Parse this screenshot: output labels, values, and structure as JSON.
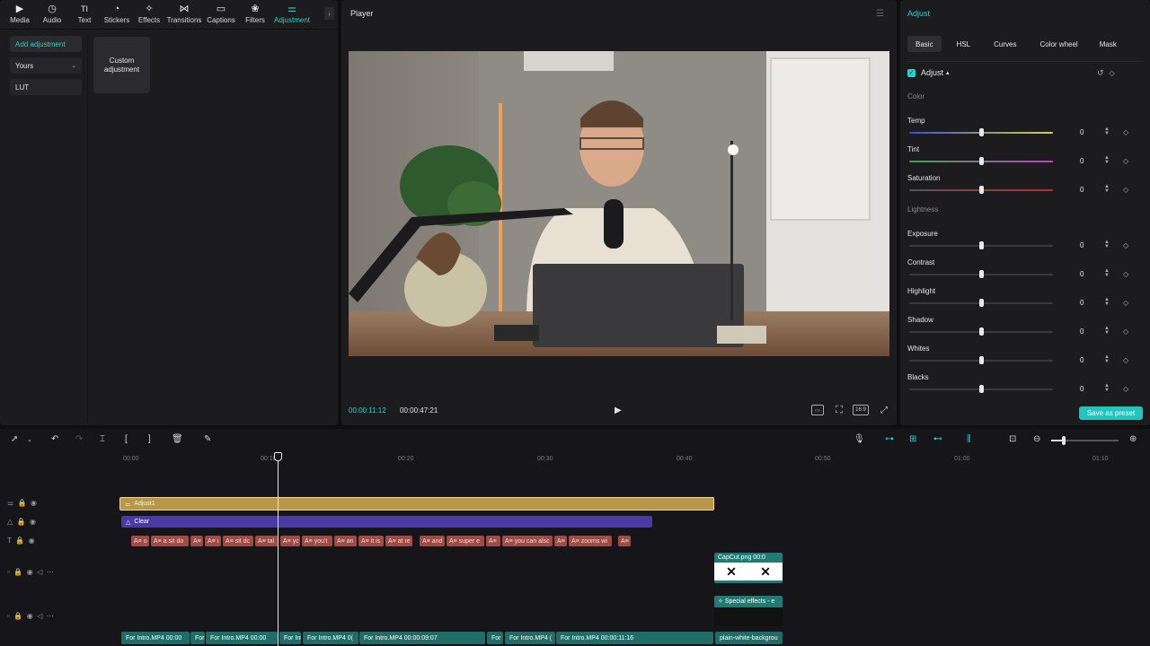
{
  "toolbar": {
    "items": [
      {
        "label": "Media",
        "icon": "media-icon",
        "glyph": "▶"
      },
      {
        "label": "Audio",
        "icon": "audio-icon",
        "glyph": "◷"
      },
      {
        "label": "Text",
        "icon": "text-icon",
        "glyph": "TI"
      },
      {
        "label": "Stickers",
        "icon": "stickers-icon",
        "glyph": "◔"
      },
      {
        "label": "Effects",
        "icon": "effects-icon",
        "glyph": "✧"
      },
      {
        "label": "Transitions",
        "icon": "transitions-icon",
        "glyph": "⋈"
      },
      {
        "label": "Captions",
        "icon": "captions-icon",
        "glyph": "▭"
      },
      {
        "label": "Filters",
        "icon": "filters-icon",
        "glyph": "❀"
      },
      {
        "label": "Adjustment",
        "icon": "adjustment-icon",
        "glyph": "⚌"
      }
    ],
    "more": "›"
  },
  "left_panel": {
    "add_adjustment": "Add adjustment",
    "yours": "Yours",
    "lut": "LUT",
    "card_label": "Custom adjustment"
  },
  "player": {
    "title": "Player",
    "current_time": "00:00:11:12",
    "total_time": "00:00:47:21",
    "ratio": "16:9"
  },
  "adjust": {
    "title": "Adjust",
    "tabs": [
      "Basic",
      "HSL",
      "Curves",
      "Color wheel",
      "Mask"
    ],
    "section_adjust": "Adjust",
    "color_label": "Color",
    "lightness_label": "Lightness",
    "rows": [
      {
        "label": "Temp",
        "value": "0"
      },
      {
        "label": "Tint",
        "value": "0"
      },
      {
        "label": "Saturation",
        "value": "0"
      },
      {
        "label": "Exposure",
        "value": "0"
      },
      {
        "label": "Contrast",
        "value": "0"
      },
      {
        "label": "Highlight",
        "value": "0"
      },
      {
        "label": "Shadow",
        "value": "0"
      },
      {
        "label": "Whites",
        "value": "0"
      },
      {
        "label": "Blacks",
        "value": "0"
      }
    ],
    "save_preset": "Save as preset"
  },
  "timeline": {
    "ticks": [
      "00:00",
      "00:10",
      "00:20",
      "00:30",
      "00:40",
      "00:50",
      "01:00",
      "01:10"
    ],
    "adjust_clip": "Adjust1",
    "filter_clip": "Clear",
    "text_chips": [
      "A≡ o",
      "A≡ a sit do",
      "A≡",
      "A≡ i",
      "A≡ sit dc",
      "A≡ tal",
      "A≡ yc",
      "A≡ you't",
      "A≡ an",
      "A≡ it is",
      "A≡ at re",
      "A≡ and",
      "A≡ super e",
      "A≡",
      "A≡ you can alsc",
      "A≡",
      "A≡ zooms wi",
      "A≡"
    ],
    "capcut_clip": "CapCut.png  00:0",
    "effects_clip": "Special effects - e",
    "main_clips": [
      "For Intro.MP4  00:00",
      "For",
      "For Intro.MP4  00:00",
      "For Int",
      "For Intro.MP4  0(",
      "For Intro.MP4  00:00:09:07",
      "For",
      "For Intro.MP4  (",
      "For Intro.MP4  00:00:11:16",
      "plain-white-backgrou"
    ]
  }
}
